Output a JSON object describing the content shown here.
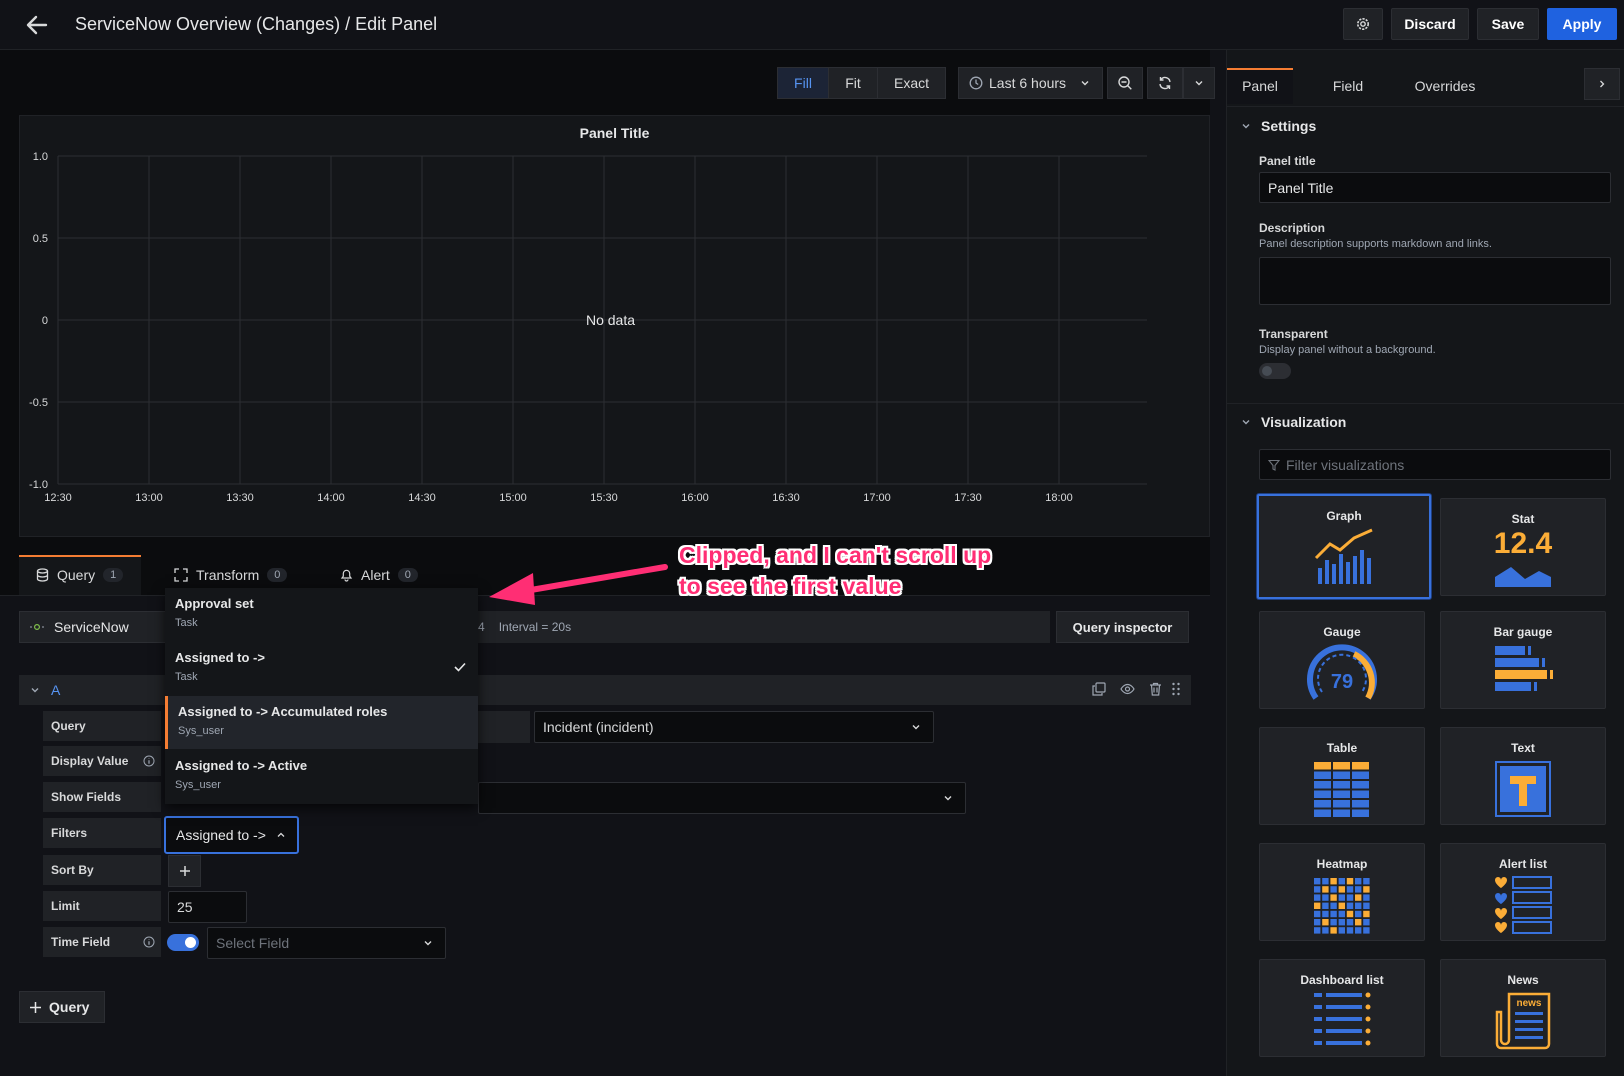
{
  "header": {
    "title": "ServiceNow Overview (Changes) / Edit Panel",
    "discard_label": "Discard",
    "save_label": "Save",
    "apply_label": "Apply"
  },
  "toolbar": {
    "fill_label": "Fill",
    "fit_label": "Fit",
    "exact_label": "Exact",
    "time_range": "Last 6 hours"
  },
  "panel": {
    "title": "Panel Title",
    "no_data": "No data"
  },
  "chart_data": {
    "type": "line",
    "title": "Panel Title",
    "x": [
      "12:30",
      "13:00",
      "13:30",
      "14:00",
      "14:30",
      "15:00",
      "15:30",
      "16:00",
      "16:30",
      "17:00",
      "17:30",
      "18:00"
    ],
    "y_ticks": [
      "1.0",
      "0.5",
      "0",
      "-0.5",
      "-1.0"
    ],
    "ylim": [
      -1.0,
      1.0
    ],
    "series": [],
    "grid": true,
    "annotation": "No data"
  },
  "query_tabs": [
    {
      "label": "Query",
      "count": "1"
    },
    {
      "label": "Transform",
      "count": "0"
    },
    {
      "label": "Alert",
      "count": "0"
    }
  ],
  "datasource": {
    "name": "ServiceNow",
    "meta_partial": "4",
    "interval": "Interval = 20s",
    "inspector_label": "Query inspector"
  },
  "query_row": {
    "letter": "A"
  },
  "form": {
    "query_label": "Query",
    "display_value_label": "Display Value",
    "show_fields_label": "Show Fields",
    "filters_label": "Filters",
    "sort_by_label": "Sort By",
    "limit_label": "Limit",
    "time_field_label": "Time Field",
    "table_value": "Incident (incident)",
    "filter_value": "Assigned to ->",
    "limit_value": "25",
    "time_field_placeholder": "Select Field",
    "add_query_label": "Query"
  },
  "dropdown": {
    "items": [
      {
        "title": "Approval set",
        "sub": "Task"
      },
      {
        "title": "Assigned to ->",
        "sub": "Task"
      },
      {
        "title": "Assigned to -> Accumulated roles",
        "sub": "Sys_user"
      },
      {
        "title": "Assigned to -> Active",
        "sub": "Sys_user"
      }
    ]
  },
  "annotation": {
    "line1": "Clipped, and I can't scroll up",
    "line2": "to see the first value",
    "color": "#ff2e74"
  },
  "options": {
    "tabs": [
      "Panel",
      "Field",
      "Overrides"
    ],
    "settings_header": "Settings",
    "panel_title_label": "Panel title",
    "panel_title_value": "Panel Title",
    "description_label": "Description",
    "description_help": "Panel description supports markdown and links.",
    "transparent_label": "Transparent",
    "transparent_help": "Display panel without a background.",
    "visualization_header": "Visualization",
    "filter_placeholder": "Filter visualizations",
    "viz": [
      "Graph",
      "Stat",
      "Gauge",
      "Bar gauge",
      "Table",
      "Text",
      "Heatmap",
      "Alert list",
      "Dashboard list",
      "News"
    ],
    "stat_value": "12.4",
    "gauge_value": "79",
    "news_label": "news"
  },
  "colors": {
    "accent_blue": "#1f62e0",
    "orange": "#f57d33",
    "viz_blue": "#3871dc",
    "viz_yellow": "#fbad37"
  }
}
